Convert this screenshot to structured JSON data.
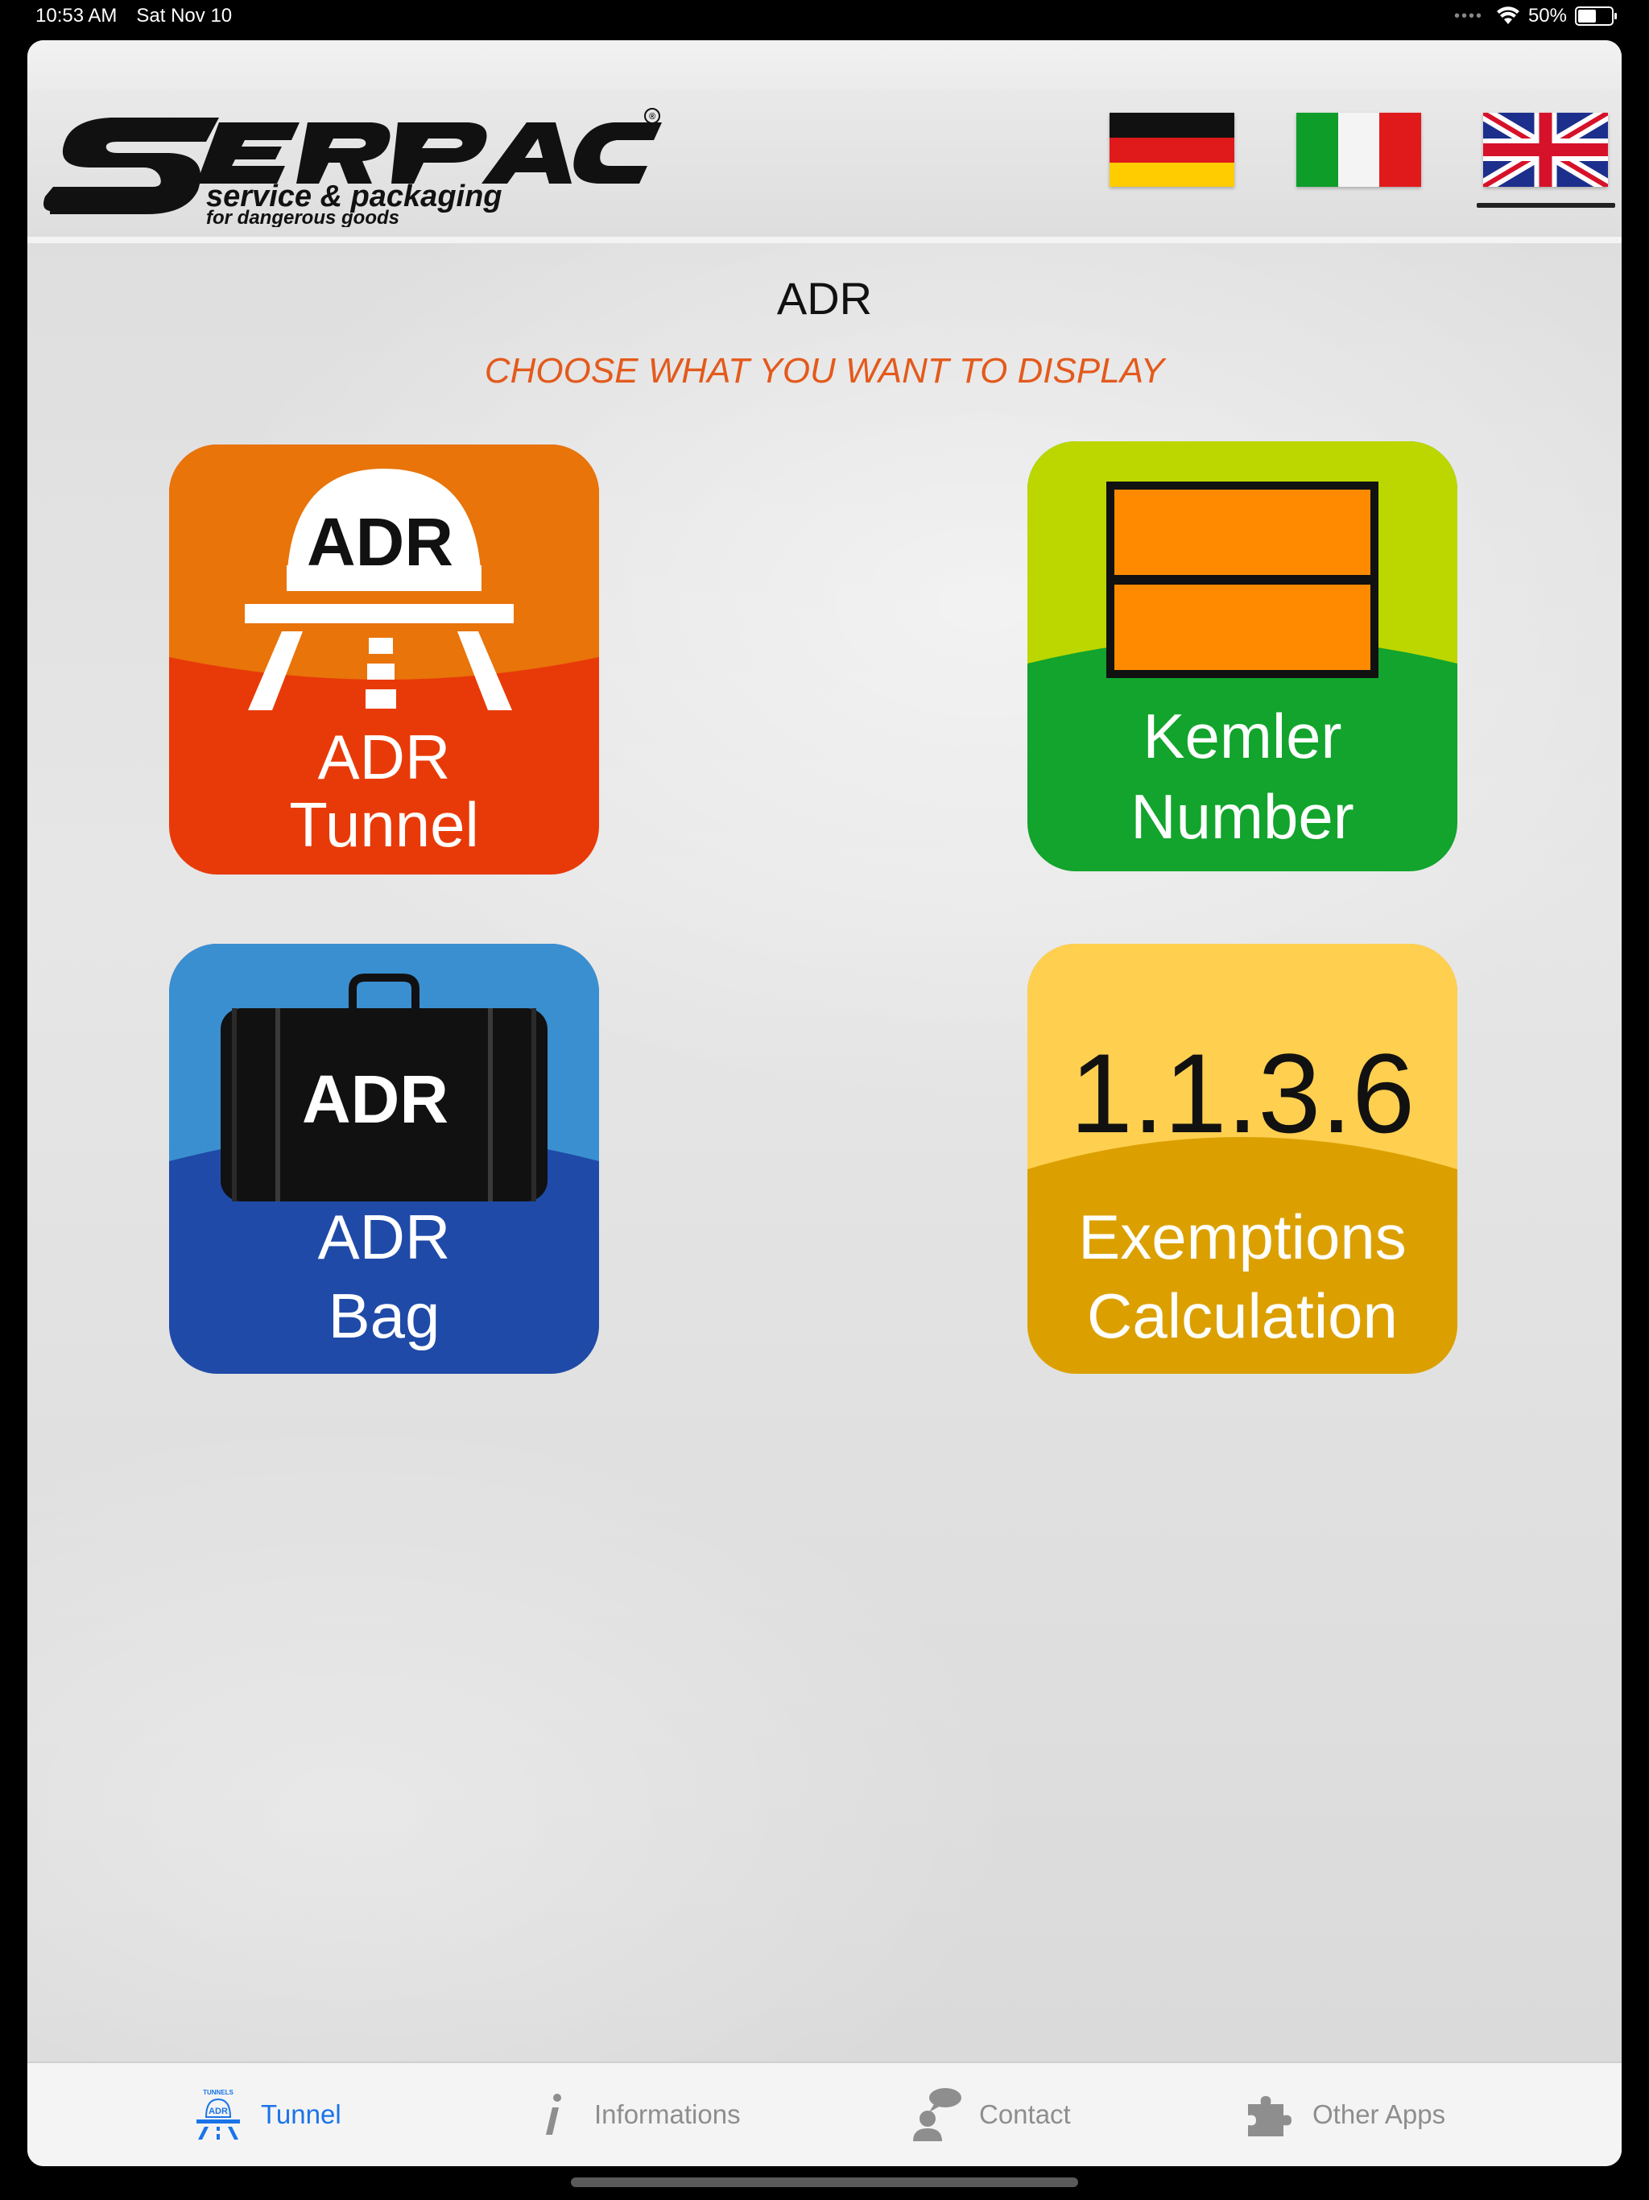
{
  "status_bar": {
    "time": "10:53 AM",
    "date": "Sat Nov 10",
    "battery": "50%",
    "battery_level": 0.5
  },
  "brand": {
    "logo_name": "SERPAC",
    "tagline": "service & packaging",
    "subtagline": "for dangerous goods",
    "registered_mark": "®"
  },
  "languages": [
    {
      "code": "de",
      "icon": "german-flag-icon",
      "selected": false
    },
    {
      "code": "it",
      "icon": "italian-flag-icon",
      "selected": false
    },
    {
      "code": "en",
      "icon": "uk-flag-icon",
      "selected": true
    }
  ],
  "main": {
    "title": "ADR",
    "subtitle": "CHOOSE WHAT YOU WANT TO DISPLAY",
    "tiles": [
      {
        "id": "tunnel",
        "icon_text": "ADR",
        "line1": "ADR",
        "line2": "Tunnel",
        "colors": {
          "top": "#e8740a",
          "bottom": "#e83a08"
        }
      },
      {
        "id": "kemler",
        "line1": "Kemler",
        "line2": "Number",
        "colors": {
          "top": "#bcd600",
          "bottom": "#12a42c",
          "plate": "#ff8a00"
        }
      },
      {
        "id": "bag",
        "icon_text": "ADR",
        "line1": "ADR",
        "line2": "Bag",
        "colors": {
          "top": "#3a8fd0",
          "bottom": "#1f4aa8"
        }
      },
      {
        "id": "exemptions",
        "icon_text": "1.1.3.6",
        "line1": "Exemptions",
        "line2": "Calculation",
        "colors": {
          "top": "#ffcf50",
          "bottom": "#dba000"
        }
      }
    ]
  },
  "tab_bar": {
    "active_color": "#1a74e8",
    "inactive_color": "#8e8e8e",
    "tabs": [
      {
        "label": "Tunnel",
        "icon": "adr-tunnel-icon",
        "icon_caption": "TUNNELS",
        "icon_text": "ADR",
        "active": true
      },
      {
        "label": "Informations",
        "icon": "info-icon",
        "active": false
      },
      {
        "label": "Contact",
        "icon": "contact-icon",
        "active": false
      },
      {
        "label": "Other Apps",
        "icon": "puzzle-icon",
        "active": false
      }
    ]
  }
}
